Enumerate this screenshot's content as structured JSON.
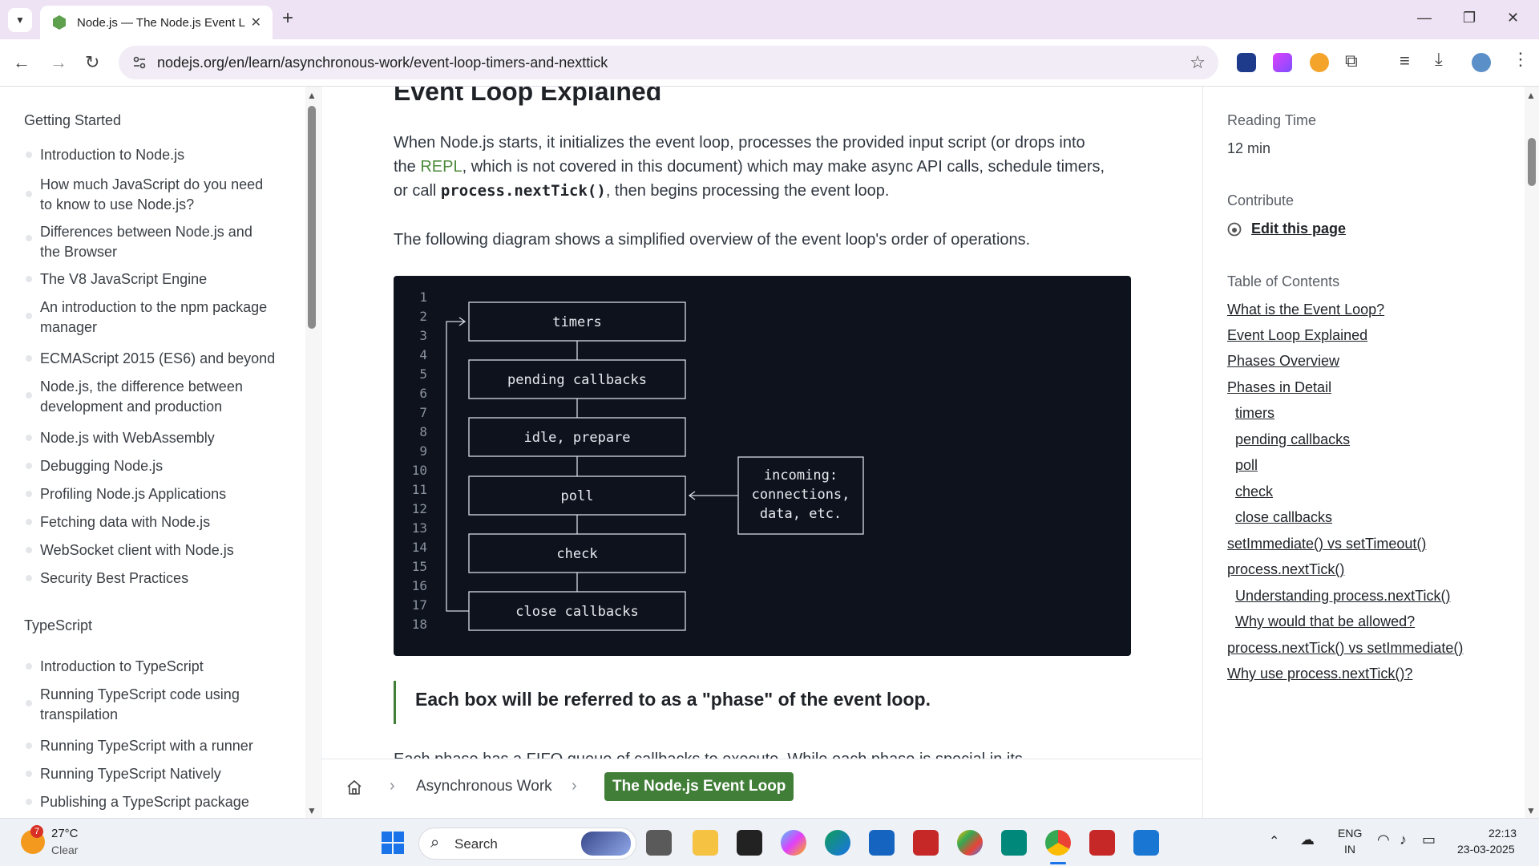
{
  "browser": {
    "tab_title": "Node.js — The Node.js Event Lo",
    "url": "nodejs.org/en/learn/asynchronous-work/event-loop-timers-and-nexttick"
  },
  "sidebar": {
    "section1": "Getting Started",
    "items1": [
      "Introduction to Node.js",
      "How much JavaScript do you need",
      "to know to use Node.js?",
      "Differences between Node.js and",
      "the Browser",
      "The V8 JavaScript Engine",
      "An introduction to the npm package",
      "manager",
      "ECMAScript 2015 (ES6) and beyond",
      "Node.js, the difference between",
      "development and production",
      "Node.js with WebAssembly",
      "Debugging Node.js",
      "Profiling Node.js Applications",
      "Fetching data with Node.js",
      "WebSocket client with Node.js",
      "Security Best Practices"
    ],
    "section2": "TypeScript",
    "items2": [
      "Introduction to TypeScript",
      "Running TypeScript code using",
      "transpilation",
      "Running TypeScript with a runner",
      "Running TypeScript Natively",
      "Publishing a TypeScript package"
    ]
  },
  "main": {
    "heading": "Event Loop Explained",
    "p1_a": "When Node.js starts, it initializes the event loop, processes the provided input script (or drops into",
    "p1_b_pre": "the ",
    "p1_b_link": "REPL",
    "p1_b_post": ", which is not covered in this document) which may make async API calls, schedule timers,",
    "p1_c_pre": "or call ",
    "p1_c_code": "process.nextTick()",
    "p1_c_post": ", then begins processing the event loop.",
    "p2": "The following diagram shows a simplified overview of the event loop's order of operations.",
    "diagram": {
      "line_numbers": [
        "1",
        "2",
        "3",
        "4",
        "5",
        "6",
        "7",
        "8",
        "9",
        "10",
        "11",
        "12",
        "13",
        "14",
        "15",
        "16",
        "17",
        "18"
      ],
      "boxes": [
        "timers",
        "pending callbacks",
        "idle, prepare",
        "poll",
        "check",
        "close callbacks"
      ],
      "side_box": [
        "incoming:",
        "connections,",
        "data, etc."
      ]
    },
    "quote": "Each box will be referred to as a \"phase\" of the event loop.",
    "cutoff": "Each phase has a FIFO queue of callbacks to execute. While each phase is special in its",
    "breadcrumb": {
      "item": "Asynchronous Work",
      "current": "The Node.js Event Loop"
    }
  },
  "right": {
    "reading_label": "Reading Time",
    "reading_value": "12 min",
    "contribute_label": "Contribute",
    "edit_link": "Edit this page",
    "toc_label": "Table of Contents",
    "toc": [
      {
        "text": "What is the Event Loop?",
        "indent": false
      },
      {
        "text": "Event Loop Explained",
        "indent": false
      },
      {
        "text": "Phases Overview",
        "indent": false
      },
      {
        "text": "Phases in Detail",
        "indent": false
      },
      {
        "text": "timers",
        "indent": true
      },
      {
        "text": "pending callbacks",
        "indent": true
      },
      {
        "text": "poll",
        "indent": true
      },
      {
        "text": "check",
        "indent": true
      },
      {
        "text": "close callbacks",
        "indent": true
      },
      {
        "text": "setImmediate() vs setTimeout()",
        "indent": false
      },
      {
        "text": "process.nextTick()",
        "indent": false
      },
      {
        "text": "Understanding process.nextTick()",
        "indent": true
      },
      {
        "text": "Why would that be allowed?",
        "indent": true
      },
      {
        "text": "process.nextTick() vs setImmediate()",
        "indent": false
      },
      {
        "text": "Why use process.nextTick()?",
        "indent": false
      }
    ]
  },
  "taskbar": {
    "temp": "27°C",
    "weather": "Clear",
    "weather_badge": "7",
    "search": "Search",
    "lang1": "ENG",
    "lang2": "IN",
    "time": "22:13",
    "date": "23-03-2025"
  },
  "colors": {
    "brand_green": "#417e38",
    "code_bg": "#0d121c",
    "chrome_bg": "#eee3f4"
  }
}
